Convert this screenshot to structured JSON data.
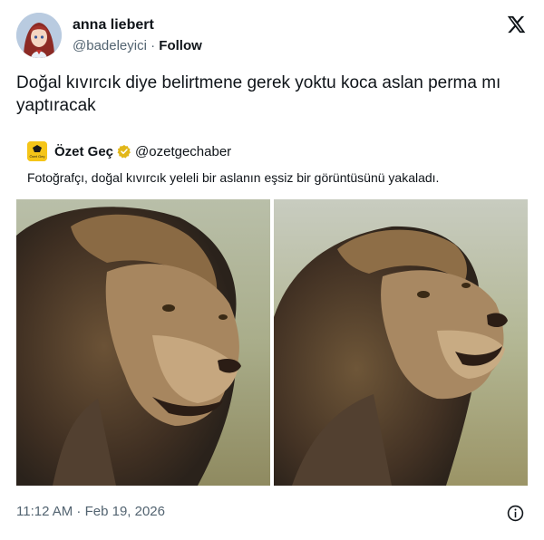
{
  "author": {
    "name": "anna liebert",
    "handle": "@badeleyici",
    "separator": "·",
    "follow_label": "Follow"
  },
  "tweet": {
    "text": "Doğal kıvırcık diye belirtmene gerek yoktu koca aslan perma mı yaptıracak"
  },
  "quote": {
    "avatar_text": "Özet Geç",
    "name": "Özet Geç",
    "handle": "@ozetgechaber",
    "text": "Fotoğrafçı, doğal kıvırcık yeleli bir aslanın eşsiz bir görüntüsünü yakaladı."
  },
  "footer": {
    "timestamp": "11:12 AM · Feb 19, 2026"
  },
  "icons": {
    "logo": "x-logo-icon",
    "verified": "verified-badge-icon",
    "info": "info-icon"
  },
  "colors": {
    "verified_gold": "#e2b719",
    "muted_text": "#536471",
    "quote_avatar_bg": "#f5c518"
  }
}
